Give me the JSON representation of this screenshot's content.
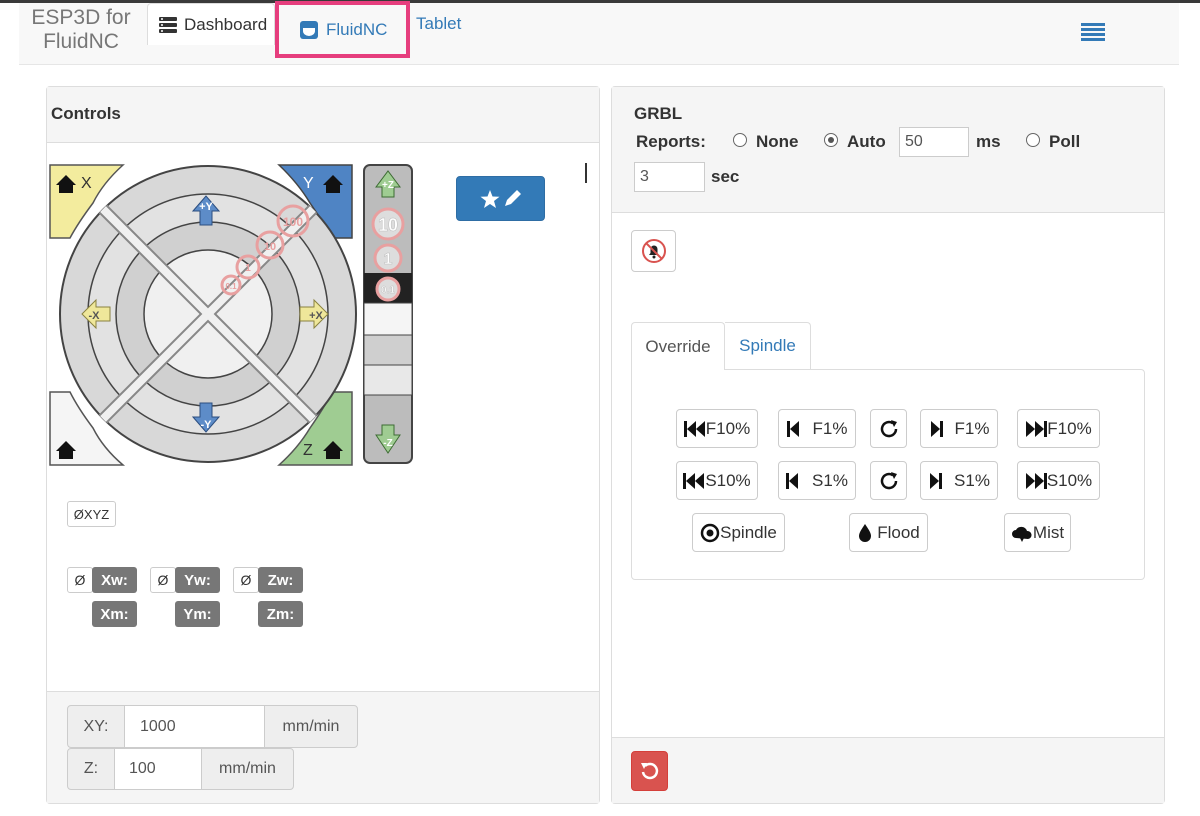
{
  "brand": {
    "line1": "ESP3D for",
    "line2": "FluidNC"
  },
  "nav": {
    "dashboard": "Dashboard",
    "fluidnc": "FluidNC",
    "tablet": "Tablet"
  },
  "controls": {
    "title": "Controls",
    "jog": {
      "x_home": "X",
      "y_home": "Y",
      "z_home": "Z",
      "plus_y": "+Y",
      "minus_y": "-Y",
      "plus_x": "+X",
      "minus_x": "-X",
      "plus_z": "+Z",
      "minus_z": "-Z",
      "step_100": "100",
      "step_10": "10",
      "step_1": "1",
      "step_01": "0.1",
      "z_step_10": "10",
      "z_step_1": "1",
      "z_step_01": "0.1"
    },
    "zero_xyz": "ØXYZ",
    "zero_symbol": "Ø",
    "work": {
      "x": "Xw:",
      "y": "Yw:",
      "z": "Zw:"
    },
    "machine": {
      "x": "Xm:",
      "y": "Ym:",
      "z": "Zm:"
    },
    "feed": {
      "xy_label": "XY:",
      "xy_value": "1000",
      "xy_unit": "mm/min",
      "z_label": "Z:",
      "z_value": "100",
      "z_unit": "mm/min"
    }
  },
  "grbl": {
    "title": "GRBL",
    "reports_label": "Reports:",
    "options": [
      "None",
      "Auto",
      "Poll"
    ],
    "selected": "Auto",
    "auto_value": "50",
    "auto_unit": "ms",
    "poll_value": "3",
    "poll_unit": "sec",
    "tabs": [
      "Override",
      "Spindle"
    ],
    "active_tab": "Override",
    "feed_buttons": [
      "F10%",
      "F1%",
      "F1%",
      "F10%"
    ],
    "speed_buttons": [
      "S10%",
      "S1%",
      "S1%",
      "S10%"
    ],
    "spindle": "Spindle",
    "flood": "Flood",
    "mist": "Mist"
  },
  "colors": {
    "accent": "#337ab7",
    "highlight": "#e63e7e",
    "danger": "#d9534f",
    "home_x": "#f5eda0",
    "home_y": "#4d7fc0",
    "home_z": "#9ec98f"
  }
}
